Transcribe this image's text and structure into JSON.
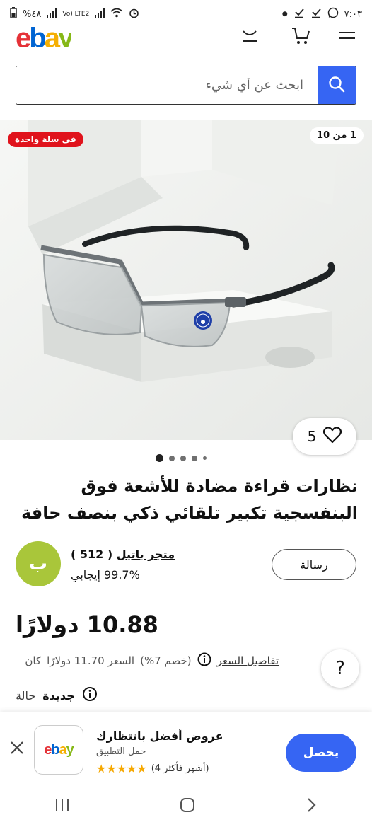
{
  "status_bar": {
    "time": "٧:٠٣",
    "battery": "%٤٨",
    "network": "Vo) LTE2"
  },
  "header": {
    "logo_letters": [
      "e",
      "b",
      "a",
      "y"
    ],
    "logo_colors": [
      "#e53238",
      "#0064d2",
      "#f5af02",
      "#86b817"
    ]
  },
  "search": {
    "placeholder": "ابحث عن أي شيء"
  },
  "image": {
    "cart_badge": "في سلة واحدة",
    "counter": "1 من 10",
    "watch_count": "5",
    "dots": 5,
    "active_dot": 0
  },
  "product": {
    "title": "نظارات قراءة مضادة للأشعة فوق البنفسجية تكبير تلقائي ذكي بنصف حافة"
  },
  "seller": {
    "avatar_letter": "ب",
    "name": "متجر باتيل",
    "count": "( 512 )",
    "feedback": "99.7% إيجابي",
    "message_button": "رسالة"
  },
  "price": {
    "value": "10.88 دولارًا",
    "details_link": "تفاصيل السعر",
    "was_label": "كان",
    "was_value": "السعر 11.70 دولارًا",
    "discount": "(خصم 7%)"
  },
  "condition": {
    "label": "حالة",
    "value": "جديدة"
  },
  "app_banner": {
    "title": "عروض أفضل بانتظارك",
    "subtitle": "حمل التطبيق",
    "rating_text": "(4 أشهر فأكثر)",
    "stars": "★★★★★",
    "get_button": "يحصل",
    "logo_text": "ebay"
  },
  "colors": {
    "accent": "#3665f3",
    "badge_red": "#e0131c",
    "avatar_green": "#a9c63a"
  }
}
